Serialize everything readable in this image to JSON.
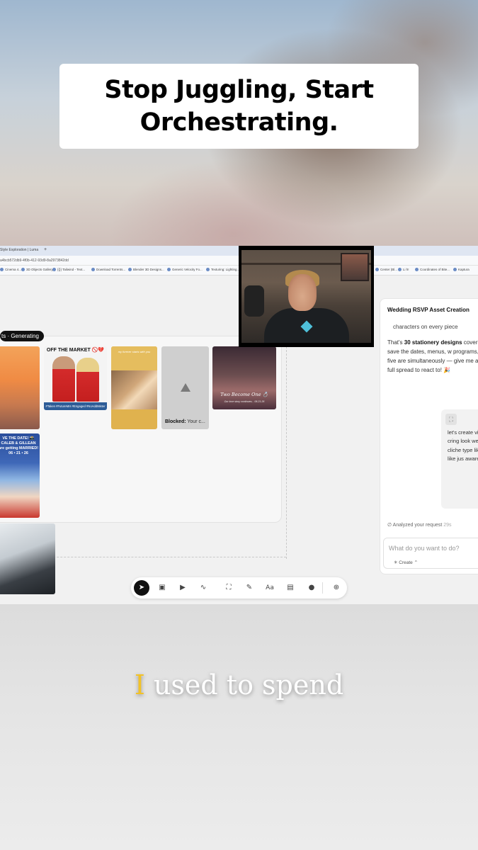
{
  "headline": "Stop Juggling, Start Orchestrating.",
  "browser": {
    "tab_title": "Style Exploration | Luma",
    "tab_plus": "+",
    "url": "a4bcb572db9-4f0b-412-93d9-8a2973842dd",
    "bookmarks": [
      "Cinema 4...",
      "3D Objects Gallery",
      "{{}} Tailwind - Text...",
      "Download Torrents...",
      "Blender 3D Designs...",
      "Generic Velocity Fo...",
      "Texturing: Lighting...",
      "Center (Bl...",
      "Li h!",
      "Coordinates of Bite...",
      "Kaptura"
    ]
  },
  "panel": {
    "pill_label": "ts · Generating",
    "cards": {
      "off_market_title": "OFF THE MARKET 🚫💔",
      "off_market_footer": "#Taken #FutureMrs #Engaged #NoAddMister",
      "cream_card_text": "my forever starts with you",
      "blocked_label": "Blocked:",
      "blocked_text": " Your c...",
      "two_become_one_title": "Two Become One 💍",
      "two_become_one_sub": "Our love story continues... 06.21.26",
      "save_date_text": "VE THE DATE! 📸 CALEB & GILLEAN are getting MARRIED! 06 • 21 • 26"
    }
  },
  "chat": {
    "title": "Wedding RSVP Asset Creation",
    "line1": "characters on every piece",
    "summary_pre": "That's ",
    "summary_bold": "30 stationery designs",
    "summary_post": " covering cards, save the dates, menus, w programs, and more. All five are simultaneously — give me a few have a full spread to react to! 🎉",
    "user_message": "let's create viral worthy most cring look we're c like just like cliche type like make p that like jus aware it wo",
    "status_label": "Analyzed your request",
    "status_time": "29s",
    "input_placeholder": "What do you want to do?",
    "create_label": "Create"
  },
  "toolbar": {
    "tools": [
      {
        "name": "select-tool",
        "glyph": "➤",
        "active": true
      },
      {
        "name": "image-tool",
        "glyph": "▣"
      },
      {
        "name": "video-tool",
        "glyph": "▶"
      },
      {
        "name": "audio-tool",
        "glyph": "∿"
      },
      {
        "name": "frame-tool",
        "glyph": "⛶"
      },
      {
        "name": "draw-tool",
        "glyph": "✎"
      },
      {
        "name": "text-tool",
        "glyph": "Aa"
      },
      {
        "name": "board-tool",
        "glyph": "▤"
      },
      {
        "name": "color-tool",
        "glyph": "●"
      },
      {
        "name": "add-tool",
        "glyph": "⊕"
      }
    ]
  },
  "caption": {
    "highlight": "I",
    "rest": " used to spend"
  },
  "colors": {
    "caption_highlight": "#f2c227",
    "pill_bg": "#111111"
  }
}
